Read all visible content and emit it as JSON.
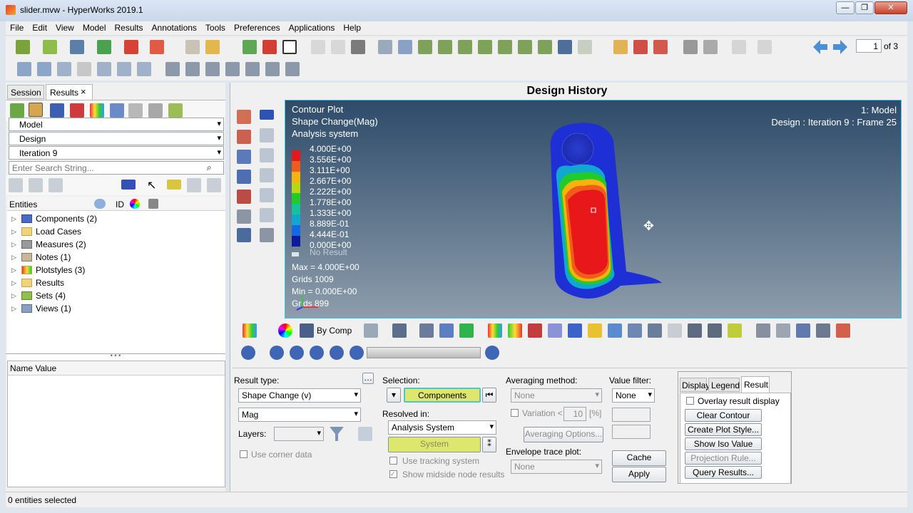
{
  "window": {
    "title": "slider.mvw - HyperWorks 2019.1"
  },
  "menu": [
    "File",
    "Edit",
    "View",
    "Model",
    "Results",
    "Annotations",
    "Tools",
    "Preferences",
    "Applications",
    "Help"
  ],
  "pager": {
    "current": "1",
    "total": "of 3"
  },
  "left_tabs": {
    "session": "Session",
    "results": "Results",
    "close": "×"
  },
  "selectors": {
    "model": "Model",
    "design": "Design",
    "iteration": "Iteration 9"
  },
  "search": {
    "placeholder": "Enter Search String..."
  },
  "entities_header": {
    "entities": "Entities",
    "id": "ID"
  },
  "tree": [
    {
      "label": "Components (2)"
    },
    {
      "label": "Load Cases"
    },
    {
      "label": "Measures (2)"
    },
    {
      "label": "Notes (1)"
    },
    {
      "label": "Plotstyles (3)"
    },
    {
      "label": "Results"
    },
    {
      "label": "Sets (4)"
    },
    {
      "label": "Views (1)"
    }
  ],
  "name_value_header": "Name Value",
  "status": "0 entities selected",
  "viewport": {
    "heading": "Design History",
    "plot_title": "Contour Plot",
    "plot_sub": "Shape Change(Mag)",
    "plot_sys": "Analysis system",
    "model_label": "1: Model",
    "design_label": "Design : Iteration 9 : Frame 25",
    "legend_values": [
      "4.000E+00",
      "3.556E+00",
      "3.111E+00",
      "2.667E+00",
      "2.222E+00",
      "1.778E+00",
      "1.333E+00",
      "8.889E-01",
      "4.444E-01",
      "0.000E+00"
    ],
    "legend_colors": [
      "#e8171a",
      "#f05c1a",
      "#f6b20d",
      "#b9d80f",
      "#22cc28",
      "#13c49a",
      "#10a8d0",
      "#1468e2",
      "#1f2fd6",
      "#0e1a9c"
    ],
    "no_result": "No Result",
    "max": "Max =  4.000E+00",
    "max_grids": "Grids 1009",
    "min": "Min =  0.000E+00",
    "min_grids": "Grids 899",
    "bg_top": "#2e4b6a",
    "bg_bottom": "#8d9dac"
  },
  "bottom_toolbar": {
    "by_comp": "By Comp"
  },
  "controls": {
    "result_type_label": "Result type:",
    "result_type": "Shape Change (v)",
    "component": "Mag",
    "layers_label": "Layers:",
    "use_corner": "Use corner data",
    "selection_label": "Selection:",
    "selection_btn": "Components",
    "resolved_label": "Resolved in:",
    "resolved": "Analysis System",
    "system_btn": "System",
    "use_tracking": "Use tracking system",
    "show_midside": "Show midside node results",
    "averaging_label": "Averaging method:",
    "averaging": "None",
    "variation": "Variation <",
    "variation_val": "10",
    "pct": "[%]",
    "averaging_options": "Averaging Options...",
    "envelope_label": "Envelope trace plot:",
    "envelope": "None",
    "value_filter_label": "Value filter:",
    "value_filter": "None",
    "cache": "Cache",
    "apply": "Apply",
    "tabs": [
      "Display",
      "Legend",
      "Result"
    ],
    "overlay": "Overlay result display",
    "btns": [
      "Clear Contour",
      "Create Plot Style...",
      "Show Iso Value",
      "Projection Rule...",
      "Query Results..."
    ]
  }
}
